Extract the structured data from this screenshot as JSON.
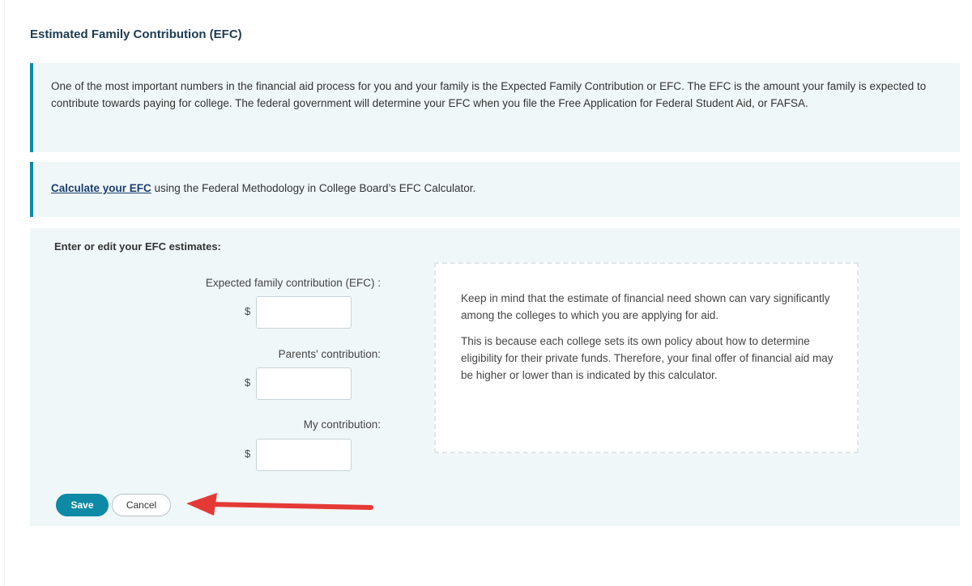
{
  "section": {
    "title": "Estimated Family Contribution (EFC)"
  },
  "intro": {
    "text": "One of the most important numbers in the financial aid process for you and your family is the Expected Family Contribution or EFC. The EFC is the amount your family is expected to contribute towards paying for college. The federal government will determine your EFC when you file the Free Application for Federal Student Aid, or FAFSA."
  },
  "calculator": {
    "link_label": "Calculate your EFC",
    "text": " using the Federal Methodology in College Board’s EFC Calculator."
  },
  "form": {
    "heading": "Enter or edit your EFC estimates:",
    "fields": [
      {
        "label": "Expected family contribution (EFC) :",
        "currency": "$",
        "value": ""
      },
      {
        "label": "Parents' contribution:",
        "currency": "$",
        "value": ""
      },
      {
        "label": "My contribution:",
        "currency": "$",
        "value": ""
      }
    ],
    "info": {
      "paragraph1": "Keep in mind that the estimate of financial need shown can vary significantly among the colleges to which you are applying for aid.",
      "paragraph2": "This is because each college sets its own policy about how to determine eligibility for their private funds. Therefore, your final offer of financial aid may be higher or lower than is indicated by this calculator."
    },
    "save_label": "Save",
    "cancel_label": "Cancel"
  },
  "colors": {
    "accent": "#0e8aa6",
    "panel_bg": "#f0f7f9",
    "title": "#1d3b52",
    "link": "#1a3e70",
    "annotation_arrow": "#e53935"
  },
  "annotation": {
    "icon": "arrow-left-icon"
  }
}
